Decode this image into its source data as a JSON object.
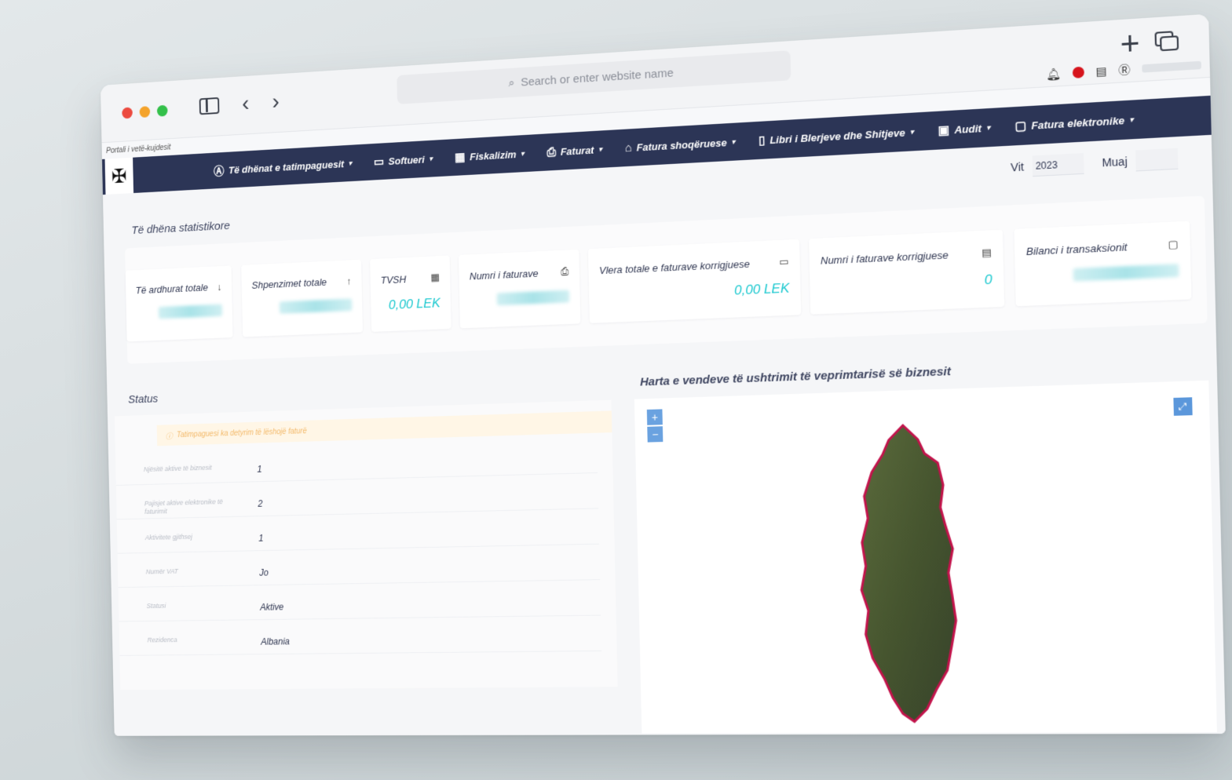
{
  "browser": {
    "url_placeholder": "Search or enter website name"
  },
  "portal": {
    "label": "Portali i vetë-kujdesit"
  },
  "nav": {
    "items": [
      {
        "label": "Të dhënat e tatimpaguesit",
        "icon": "user-circle-icon"
      },
      {
        "label": "Softueri",
        "icon": "laptop-icon"
      },
      {
        "label": "Fiskalizim",
        "icon": "calculator-icon"
      },
      {
        "label": "Faturat",
        "icon": "printer-icon"
      },
      {
        "label": "Fatura shoqëruese",
        "icon": "warehouse-icon"
      },
      {
        "label": "Libri i Blerjeve dhe Shitjeve",
        "icon": "book-icon"
      },
      {
        "label": "Audit",
        "icon": "document-chart-icon"
      },
      {
        "label": "Fatura elektronike",
        "icon": "document-icon"
      }
    ]
  },
  "filters": {
    "year_label": "Vit",
    "year_value": "2023",
    "month_label": "Muaj"
  },
  "stats": {
    "title": "Të dhëna statistikore",
    "cards": [
      {
        "label": "Të ardhurat totale",
        "icon": "arrow-down-icon",
        "value": ""
      },
      {
        "label": "Shpenzimet totale",
        "icon": "arrow-up-icon",
        "value": ""
      },
      {
        "label": "TVSH",
        "icon": "calculator-icon",
        "value": "0,00 LEK"
      },
      {
        "label": "Numri i faturave",
        "icon": "printer-icon",
        "value": ""
      },
      {
        "label": "Vlera totale e faturave korrigjuese",
        "icon": "money-icon",
        "value": "0,00 LEK"
      },
      {
        "label": "Numri i faturave korrigjuese",
        "icon": "clipboard-icon",
        "value": "0"
      },
      {
        "label": "Bilanci i transaksionit",
        "icon": "wallet-icon",
        "value": ""
      }
    ]
  },
  "status": {
    "title": "Status",
    "warning": "Tatimpaguesi ka detyrim të lëshojë faturë",
    "rows": [
      {
        "label": "Njësitë aktive të biznesit",
        "value": "1"
      },
      {
        "label": "Pajisjet aktive elektronike të faturimit",
        "value": "2"
      },
      {
        "label": "Aktivitete gjithsej",
        "value": "1"
      },
      {
        "label": "Numër VAT",
        "value": "Jo"
      },
      {
        "label": "Statusi",
        "value": "Aktive"
      },
      {
        "label": "Rezidenca",
        "value": "Albania"
      }
    ]
  },
  "map": {
    "title": "Harta e vendeve të ushtrimit të veprimtarisë së biznesit",
    "zoom_in": "+",
    "zoom_out": "−"
  },
  "colors": {
    "navbar": "#2c3556",
    "accent_value": "#1ac8cf",
    "map_border": "#c2134b"
  }
}
